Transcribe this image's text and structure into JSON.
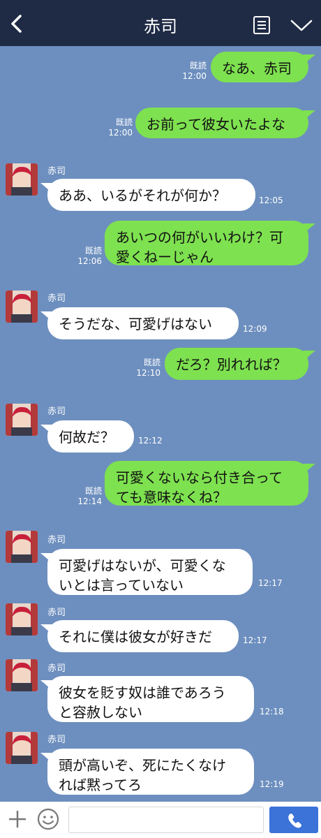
{
  "header": {
    "title": "赤司"
  },
  "contact": {
    "name": "赤司"
  },
  "messages": [
    {
      "side": "right",
      "text": "なあ、赤司",
      "read": "既読",
      "time": "12:00"
    },
    {
      "side": "right",
      "text": "お前って彼女いたよな",
      "read": "既読",
      "time": "12:00"
    },
    {
      "side": "left",
      "name": "赤司",
      "text": "ああ、いるがそれが何か？",
      "time": "12:05"
    },
    {
      "side": "right",
      "text": "あいつの何がいいわけ？可\n愛くねーじゃん",
      "read": "既読",
      "time": "12:06"
    },
    {
      "side": "left",
      "name": "赤司",
      "text": "そうだな、可愛げはない",
      "time": "12:09"
    },
    {
      "side": "right",
      "text": "だろ？別れれば？",
      "read": "既読",
      "time": "12:10"
    },
    {
      "side": "left",
      "name": "赤司",
      "text": "何故だ？",
      "time": "12:12"
    },
    {
      "side": "right",
      "text": "可愛くないなら付き合って\nても意味なくね？",
      "read": "既読",
      "time": "12:14"
    },
    {
      "side": "left",
      "name": "赤司",
      "text": "可愛げはないが、可愛くな\nいとは言っていない",
      "time": "12:17"
    },
    {
      "side": "left",
      "name": "赤司",
      "text": "それに僕は彼女が好きだ",
      "time": "12:17"
    },
    {
      "side": "left",
      "name": "赤司",
      "text": "彼女を貶す奴は誰であろう\nと容赦しない",
      "time": "12:18"
    },
    {
      "side": "left",
      "name": "赤司",
      "text": "頭が高いぞ、死にたくなけ\nれば黙ってろ",
      "time": "12:19"
    }
  ],
  "input": {
    "placeholder": "",
    "value": ""
  },
  "colors": {
    "header": "#1f2b45",
    "background": "#6d8fbf",
    "sent_bubble": "#7ee150",
    "received_bubble": "#ffffff",
    "send_button": "#3b73d9"
  },
  "icons": {
    "back": "chevron-left-icon",
    "menu": "note-icon",
    "collapse": "chevron-down-icon",
    "add": "plus-icon",
    "emoji": "smile-icon",
    "send": "phone-icon"
  }
}
